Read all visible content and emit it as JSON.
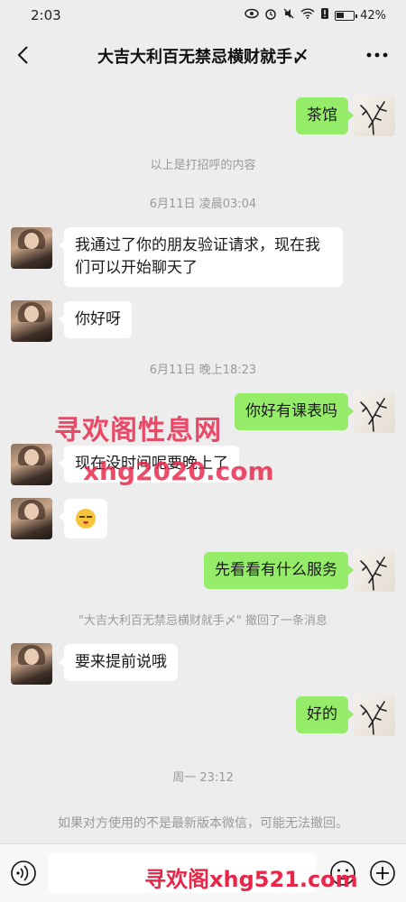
{
  "status": {
    "time": "2:03",
    "battery": "42%"
  },
  "header": {
    "title": "大吉大利百无禁忌横财就手〆"
  },
  "messages": {
    "m1": "茶馆",
    "sys1": "以上是打招呼的内容",
    "time1": "6月11日 凌晨03:04",
    "m2": "我通过了你的朋友验证请求，现在我们可以开始聊天了",
    "m3": "你好呀",
    "time2": "6月11日 晚上18:23",
    "m4": "你好有课表吗",
    "m5": "现在没时间呢要晚上了",
    "m6_emoji": "smiling-face-emoji",
    "m7": "先看看有什么服务",
    "sys2": "\"大吉大利百无禁忌横财就手〆\" 撤回了一条消息",
    "m8": "要来提前说哦",
    "m9": "好的",
    "time3": "周一 23:12",
    "sys3": "如果对方使用的不是最新版本微信，可能无法撤回。"
  },
  "watermarks": {
    "cn": "寻欢阁性息网",
    "url": "xhg2020.com",
    "bottom": "寻欢阁xhg521.com"
  },
  "colors": {
    "my_bubble": "#95ec69",
    "other_bubble": "#ffffff",
    "background": "#ededed",
    "watermark": "#e8264a"
  },
  "icons": {
    "back": "chevron-left-icon",
    "more": "more-dots-icon",
    "voice": "voice-icon",
    "emoji": "emoji-icon",
    "plus": "plus-icon"
  }
}
